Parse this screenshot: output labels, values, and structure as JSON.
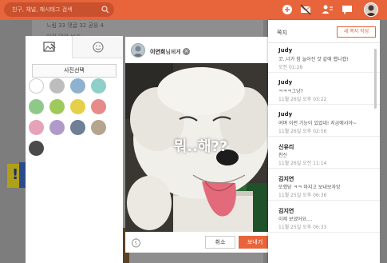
{
  "search": {
    "placeholder": "친구, 채널, 해시태그 검색"
  },
  "background": {
    "stats": "느림 33   댓글 32   공유 4",
    "link_text": "이전 댓글 보기"
  },
  "editor": {
    "photo_select_label": "사진선택",
    "swatches": [
      "#ffffff",
      "#bdbdbd",
      "#8fb1d0",
      "#8ecfc8",
      "#8fc98a",
      "#9fc95a",
      "#e6d04a",
      "#e78a8a",
      "#e6a3b8",
      "#b09ac8",
      "#6e7f96",
      "#b5a58c",
      "#4a4a4a"
    ]
  },
  "composer": {
    "recipient_name": "이연희",
    "recipient_suffix": "님에게",
    "overlay_text": "뭐..해??",
    "cancel_label": "취소",
    "send_label": "보내기"
  },
  "notes": {
    "title": "쪽지",
    "new_note_label": "새 쪽지 작성",
    "items": [
      {
        "sender": "Judy",
        "preview": "코..너가 참 늘어진 것 같애 햅니캡!",
        "date": "오전 01:28"
      },
      {
        "sender": "Judy",
        "preview": "ㅋㅋㅋ그냥?",
        "date": "11월 26일 오후 03:22"
      },
      {
        "sender": "Judy",
        "preview": "여며 이런 기능이 있었네! 지금에서야~",
        "date": "11월 26일 오후 02:56"
      },
      {
        "sender": "신유리",
        "preview": "친신",
        "date": "11월 26일 오전 11:14"
      },
      {
        "sender": "김지연",
        "preview": "또했당 ㅋㅋ 마지고 보내보자앙",
        "date": "11월 25일 오후 06:36"
      },
      {
        "sender": "김지연",
        "preview": "이제 보냈어요....",
        "date": "11월 25일 오후 06:33"
      }
    ]
  },
  "colors": {
    "accent": "#e8643a"
  }
}
